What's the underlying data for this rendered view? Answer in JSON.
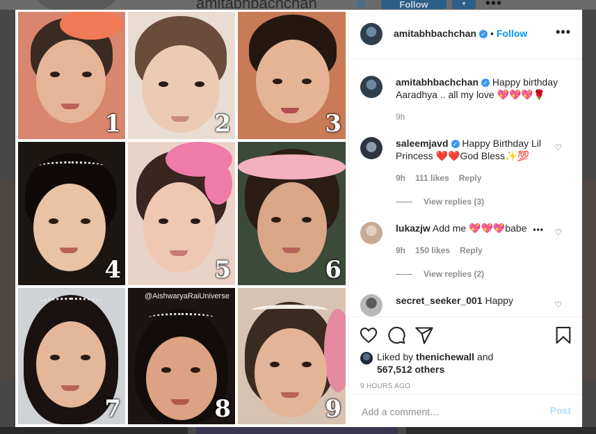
{
  "background": {
    "username": "amitabhbachchan",
    "follow_label": "Follow",
    "more_label": "•••",
    "dropdown_label": "▾"
  },
  "photo": {
    "watermark": "@AishwaryaRaiUniverse",
    "tiles": [
      {
        "number": "1"
      },
      {
        "number": "2"
      },
      {
        "number": "3"
      },
      {
        "number": "4"
      },
      {
        "number": "5"
      },
      {
        "number": "6"
      },
      {
        "number": "7"
      },
      {
        "number": "8"
      },
      {
        "number": "9"
      }
    ]
  },
  "post_header": {
    "username": "amitabhbachchan",
    "separator": "•",
    "follow_label": "Follow",
    "more_label": "•••"
  },
  "caption": {
    "username": "amitabhbachchan",
    "text": "Happy birthday Aaradhya .. all my love 💖💖💖🌹",
    "time": "9h"
  },
  "comments": [
    {
      "username": "saleemjavd",
      "verified": true,
      "text": "Happy Birthday Lil Princess ❤️❤️God Bless✨💯",
      "time": "9h",
      "likes": "111 likes",
      "reply_label": "Reply",
      "view_replies": "View replies (3)"
    },
    {
      "username": "lukazjw",
      "verified": false,
      "text": "Add me 💖💖💖babe",
      "time": "9h",
      "likes": "150 likes",
      "reply_label": "Reply",
      "view_replies": "View replies (2)"
    },
    {
      "username": "secret_seeker_001",
      "verified": false,
      "text": "Happy"
    }
  ],
  "liked_by": {
    "prefix": "Liked by",
    "user": "thenichewall",
    "and": "and",
    "others": "567,512 others"
  },
  "timestamp": "9 HOURS AGO",
  "add_comment": {
    "placeholder": "Add a comment…",
    "post_label": "Post"
  },
  "colors": {
    "accent": "#0095f6",
    "verified": "#3897f0",
    "post_disabled": "#b2dffc",
    "muted_text": "#8e8e8e"
  }
}
